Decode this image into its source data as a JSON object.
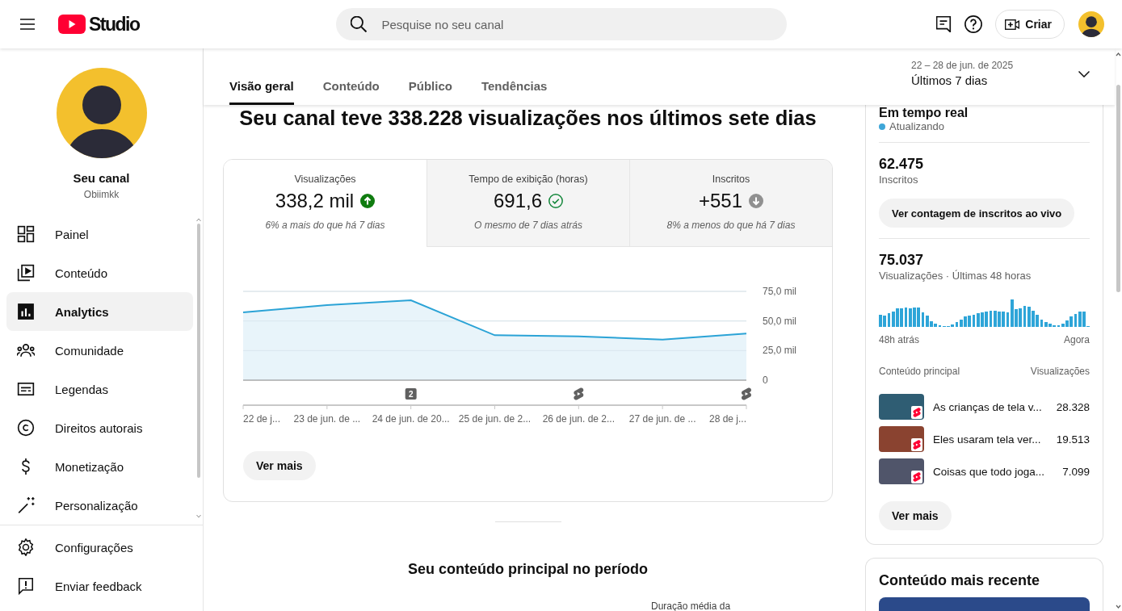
{
  "topbar": {
    "logo_text": "Studio",
    "search": {
      "placeholder": "Pesquise no seu canal"
    },
    "create_button": "Criar"
  },
  "sidebar": {
    "channel": {
      "title": "Seu canal",
      "handle": "Obiimkk"
    },
    "items": [
      {
        "label": "Painel",
        "selected": false
      },
      {
        "label": "Conteúdo",
        "selected": false
      },
      {
        "label": "Analytics",
        "selected": true
      },
      {
        "label": "Comunidade",
        "selected": false
      },
      {
        "label": "Legendas",
        "selected": false
      },
      {
        "label": "Direitos autorais",
        "selected": false
      },
      {
        "label": "Monetização",
        "selected": false
      },
      {
        "label": "Personalização",
        "selected": false
      }
    ],
    "footer_items": [
      {
        "label": "Configurações"
      },
      {
        "label": "Enviar feedback"
      }
    ]
  },
  "header": {
    "tabs": [
      {
        "label": "Visão geral",
        "selected": true
      },
      {
        "label": "Conteúdo",
        "selected": false
      },
      {
        "label": "Público",
        "selected": false
      },
      {
        "label": "Tendências",
        "selected": false
      }
    ],
    "date_range": {
      "dates": "22 – 28 de jun. de 2025",
      "label": "Últimos 7 dias"
    }
  },
  "overview": {
    "heading": "Seu canal teve 338.228 visualizações nos últimos sete dias",
    "metrics": [
      {
        "label": "Visualizações",
        "value": "338,2 mil",
        "kind": "up",
        "comparison": "6% a mais do que há 7 dias",
        "selected": true
      },
      {
        "label": "Tempo de exibição (horas)",
        "value": "691,6",
        "kind": "same",
        "comparison": "O mesmo de 7 dias atrás",
        "selected": false
      },
      {
        "label": "Inscritos",
        "value": "+551",
        "kind": "down",
        "comparison": "8% a menos do que há 7 dias",
        "selected": false
      }
    ],
    "chart_data": {
      "type": "area",
      "categories": [
        "22 de j...",
        "23 de jun. de ...",
        "24 de jun. de 20...",
        "25 de jun. de 2...",
        "26 de jun. de 2...",
        "27 de jun. de ...",
        "28 de j..."
      ],
      "values": [
        57.2,
        63.4,
        67.5,
        38.0,
        37.0,
        34.2,
        39.4
      ],
      "ylim": [
        0,
        75
      ],
      "yticks": [
        {
          "value": 0,
          "label": "0"
        },
        {
          "value": 25,
          "label": "25,0 mil"
        },
        {
          "value": 50,
          "label": "50,0 mil"
        },
        {
          "value": 75,
          "label": "75,0 mil"
        }
      ]
    },
    "timeline_markers": [
      {
        "kind": "none"
      },
      {
        "kind": "none"
      },
      {
        "kind": "count",
        "label": "2"
      },
      {
        "kind": "none"
      },
      {
        "kind": "short"
      },
      {
        "kind": "none"
      },
      {
        "kind": "short"
      }
    ],
    "more_button": "Ver mais",
    "section_title": "Seu conteúdo principal no período",
    "column_header": "Duração média da"
  },
  "realtime": {
    "title": "Em tempo real",
    "status": "Atualizando",
    "subscribers": {
      "value": "62.475",
      "label": "Inscritos",
      "button": "Ver contagem de inscritos ao vivo"
    },
    "views": {
      "value": "75.037",
      "label": "Visualizações · Últimas 48 horas",
      "start_label": "48h atrás",
      "end_label": "Agora"
    },
    "top_content": {
      "title_header": "Conteúdo principal",
      "metric_header": "Visualizações",
      "rows": [
        {
          "title": "As crianças de tela v...",
          "views": "28.328"
        },
        {
          "title": "Eles usaram tela ver...",
          "views": "19.513"
        },
        {
          "title": "Coisas que todo joga...",
          "views": "7.099"
        }
      ]
    },
    "more_button": "Ver mais"
  },
  "latest_content": {
    "title": "Conteúdo mais recente"
  }
}
